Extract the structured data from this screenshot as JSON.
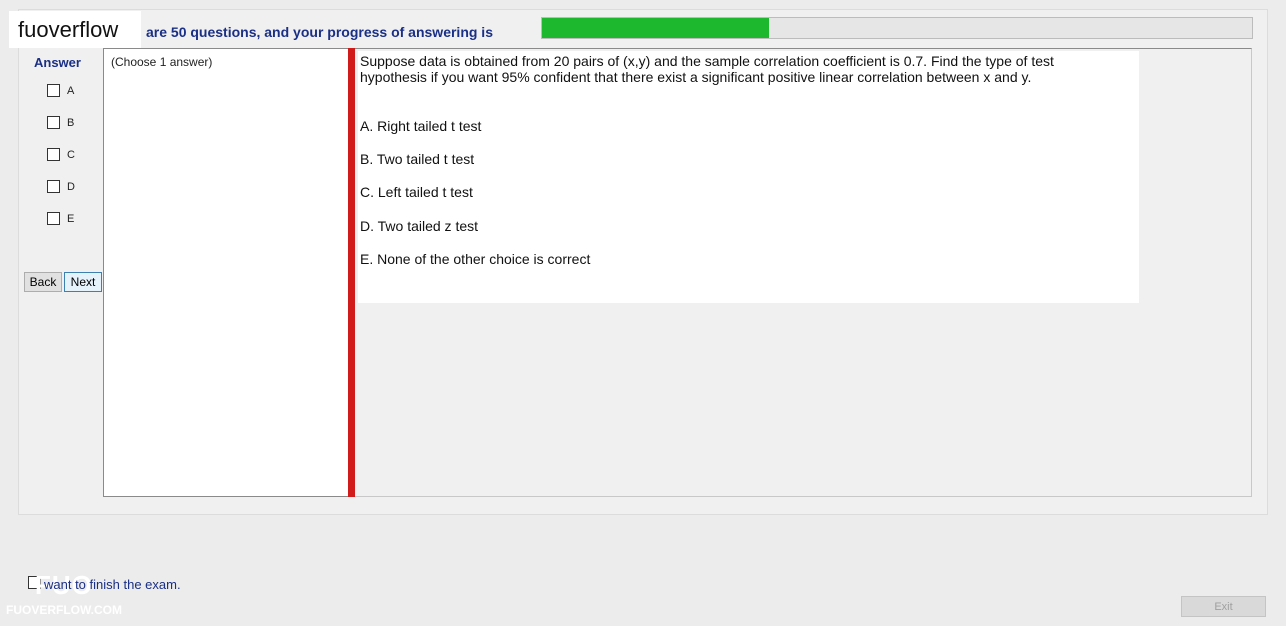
{
  "brand": "fuoverflow",
  "progress": {
    "text": "are 50 questions, and your progress of answering is",
    "value_fraction": 0.32,
    "fill_color": "#1db82d"
  },
  "answer": {
    "title": "Answer",
    "options": [
      "A",
      "B",
      "C",
      "D",
      "E"
    ]
  },
  "nav": {
    "back": "Back",
    "next": "Next"
  },
  "instructions": "(Choose 1 answer)",
  "question": {
    "text": "Suppose data is obtained from 20 pairs of (x,y) and the sample correlation coefficient is 0.7. Find the type of test hypothesis if you want 95% confident that there exist a significant positive linear correlation between x and y.",
    "choices": [
      "A.  Right tailed t test",
      "B.  Two tailed t test",
      "C.  Left tailed t test",
      "D.  Two tailed z test",
      "E.  None of the other choice is correct"
    ]
  },
  "finish": {
    "text": "want to finish the exam.",
    "button": "Finish"
  },
  "exit": "Exit",
  "logo": {
    "big": "FUO",
    "small": "FUOVERFLOW.COM"
  },
  "colors": {
    "accent_text": "#1a2f86",
    "divider": "#d11a1a"
  }
}
